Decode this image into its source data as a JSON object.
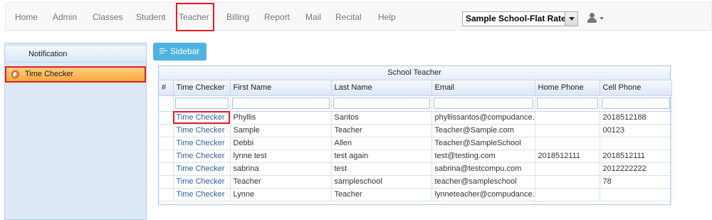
{
  "nav": {
    "items": [
      "Home",
      "Admin",
      "Classes",
      "Student",
      "Teacher",
      "Billing",
      "Report",
      "Mail",
      "Recital",
      "Help"
    ],
    "active": "Teacher"
  },
  "school_select": {
    "value": "Sample School-Flat Rate"
  },
  "user_menu": {
    "icon": "user-icon"
  },
  "sidebar": {
    "items": [
      {
        "label": "Notification",
        "icon": ""
      },
      {
        "label": "Time Checker",
        "icon": "clock-icon",
        "selected": true
      }
    ]
  },
  "sidebar_button": {
    "label": "Sidebar",
    "icon": "list-icon"
  },
  "grid": {
    "title": "School Teacher",
    "columns": [
      "#",
      "Time Checker",
      "First Name",
      "Last Name",
      "Email",
      "Home Phone",
      "Cell Phone"
    ],
    "rows": [
      [
        "",
        "Time Checker",
        "Phyllis",
        "Santos",
        "phyllissantos@compudance.com",
        "",
        "2018512188"
      ],
      [
        "",
        "Time Checker",
        "Sample",
        "Teacher",
        "Teacher@Sample.com",
        "",
        "00123"
      ],
      [
        "",
        "Time Checker",
        "Debbi",
        "Allen",
        "Teacher@SampleSchool",
        "",
        ""
      ],
      [
        "",
        "Time Checker",
        "lynne test",
        "test again",
        "test@testing.com",
        "2018512111",
        "2018512111"
      ],
      [
        "",
        "Time Checker",
        "sabrina",
        "test",
        "sabrina@testcompu.com",
        "",
        "2012222222"
      ],
      [
        "",
        "Time Checker",
        "Teacher",
        "sampleschool",
        "teacher@sampleschool",
        "",
        "78"
      ],
      [
        "",
        "Time Checker",
        "Lynne",
        "Teacher",
        "lynneteacher@compudance.com",
        "",
        ""
      ]
    ]
  },
  "colors": {
    "highlight": "#e02020",
    "link": "#2e5f98",
    "sidebar_button": "#4fb3e2",
    "selected_item": "#f8a534"
  }
}
